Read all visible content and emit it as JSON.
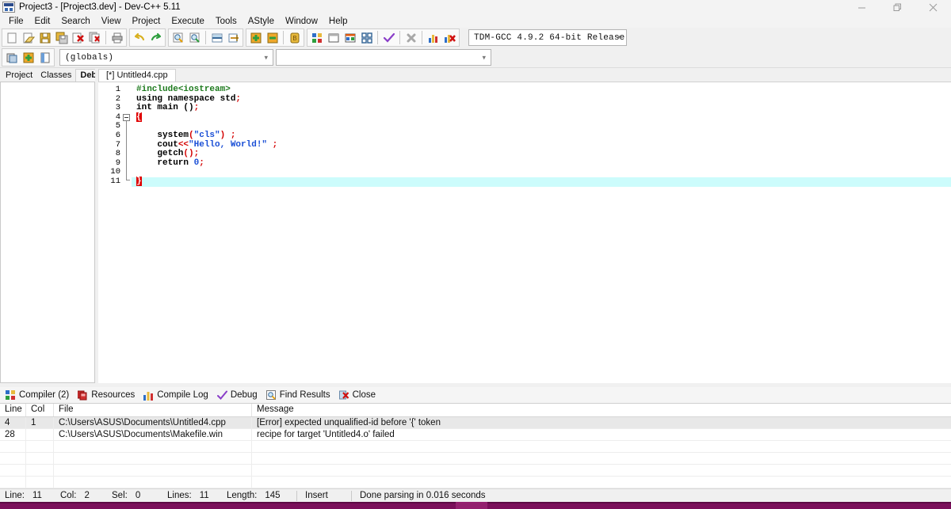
{
  "window": {
    "title": "Project3 - [Project3.dev] - Dev-C++ 5.11",
    "icon": "devcpp-app-icon",
    "controls": {
      "minimize": "minimize-icon",
      "maximize": "restore-icon",
      "close": "close-icon"
    }
  },
  "menubar": {
    "items": [
      {
        "label": "File"
      },
      {
        "label": "Edit"
      },
      {
        "label": "Search"
      },
      {
        "label": "View"
      },
      {
        "label": "Project"
      },
      {
        "label": "Execute"
      },
      {
        "label": "Tools"
      },
      {
        "label": "AStyle"
      },
      {
        "label": "Window"
      },
      {
        "label": "Help"
      }
    ]
  },
  "toolbar": {
    "file_group": [
      {
        "name": "new-file-icon",
        "title": "New"
      },
      {
        "name": "open-file-icon",
        "title": "Open"
      },
      {
        "name": "save-file-icon",
        "title": "Save"
      },
      {
        "name": "save-all-icon",
        "title": "Save All"
      },
      {
        "name": "close-file-icon",
        "title": "Close"
      },
      {
        "name": "close-all-icon",
        "title": "Close All"
      },
      {
        "name": "print-icon",
        "title": "Print"
      }
    ],
    "undo_group": [
      {
        "name": "undo-icon",
        "title": "Undo"
      },
      {
        "name": "redo-icon",
        "title": "Redo"
      }
    ],
    "search_group": [
      {
        "name": "find-icon",
        "title": "Find"
      },
      {
        "name": "replace-icon",
        "title": "Replace"
      },
      {
        "name": "goto-line-icon",
        "title": "Goto Line"
      },
      {
        "name": "goto-function-icon",
        "title": "Goto Function"
      }
    ],
    "project_group": [
      {
        "name": "add-to-project-icon",
        "title": "Add to Project"
      },
      {
        "name": "remove-from-project-icon",
        "title": "Remove from Project"
      },
      {
        "name": "project-options-icon",
        "title": "Project Options"
      }
    ],
    "compile_group": [
      {
        "name": "compile-icon",
        "title": "Compile"
      },
      {
        "name": "run-icon",
        "title": "Run"
      },
      {
        "name": "compile-run-icon",
        "title": "Compile & Run"
      },
      {
        "name": "rebuild-all-icon",
        "title": "Rebuild All"
      },
      {
        "name": "syntax-check-icon",
        "title": "Syntax Check"
      },
      {
        "name": "stop-execution-icon",
        "title": "Stop Execution"
      },
      {
        "name": "profile-icon",
        "title": "Profile Analysis"
      },
      {
        "name": "delete-profile-icon",
        "title": "Delete Profile"
      }
    ],
    "compiler_select": {
      "name": "compiler-set-combo",
      "value": "TDM-GCC 4.9.2 64-bit Release",
      "caret": "chevron-down-icon"
    },
    "debug_group": [
      {
        "name": "goto-declaration-icon",
        "title": "Goto Declaration"
      },
      {
        "name": "goto-definition-icon",
        "title": "Goto Definition"
      },
      {
        "name": "toggle-panel-icon",
        "title": "Toggle Panel"
      }
    ],
    "scope_combo": {
      "name": "scope-combo",
      "value": "(globals)",
      "caret": "chevron-down-icon"
    },
    "member_combo": {
      "name": "member-combo",
      "value": "",
      "caret": "chevron-down-icon"
    }
  },
  "left_panel": {
    "tabs": [
      {
        "label": "Project",
        "active": false
      },
      {
        "label": "Classes",
        "active": false
      },
      {
        "label": "Debug",
        "active": true
      }
    ]
  },
  "editor": {
    "tabs": [
      {
        "label": "[*] Untitled4.cpp",
        "active": true
      }
    ],
    "current_line": 11,
    "lines": [
      {
        "n": 1,
        "fold": "start-none",
        "tokens": [
          {
            "t": "#include",
            "c": "pre"
          },
          {
            "t": "<iostream>",
            "c": "pre2"
          }
        ]
      },
      {
        "n": 2,
        "tokens": [
          {
            "t": "using namespace std",
            "c": "kw"
          },
          {
            "t": ";",
            "c": "punc"
          }
        ]
      },
      {
        "n": 3,
        "tokens": [
          {
            "t": "int main ()",
            "c": "kw"
          },
          {
            "t": ";",
            "c": "punc"
          }
        ]
      },
      {
        "n": 4,
        "fold": "start",
        "tokens": [
          {
            "t": "{",
            "c": "brace"
          }
        ]
      },
      {
        "n": 5,
        "tokens": []
      },
      {
        "n": 6,
        "tokens": [
          {
            "t": "    system",
            "c": "plain"
          },
          {
            "t": "(",
            "c": "punc"
          },
          {
            "t": "\"cls\"",
            "c": "str"
          },
          {
            "t": ")",
            "c": "punc"
          },
          {
            "t": " ",
            "c": "plain"
          },
          {
            "t": ";",
            "c": "punc"
          }
        ]
      },
      {
        "n": 7,
        "tokens": [
          {
            "t": "    cout",
            "c": "plain"
          },
          {
            "t": "<<",
            "c": "punc"
          },
          {
            "t": "\"Hello, World!\"",
            "c": "str"
          },
          {
            "t": " ",
            "c": "plain"
          },
          {
            "t": ";",
            "c": "punc"
          }
        ]
      },
      {
        "n": 8,
        "tokens": [
          {
            "t": "    getch",
            "c": "plain"
          },
          {
            "t": "()",
            "c": "punc"
          },
          {
            "t": ";",
            "c": "punc"
          }
        ]
      },
      {
        "n": 9,
        "tokens": [
          {
            "t": "    return ",
            "c": "kw"
          },
          {
            "t": "0",
            "c": "num"
          },
          {
            "t": ";",
            "c": "punc"
          }
        ]
      },
      {
        "n": 10,
        "tokens": []
      },
      {
        "n": 11,
        "fold": "end",
        "highlight": true,
        "tokens": [
          {
            "t": "}",
            "c": "brace"
          }
        ]
      }
    ]
  },
  "bottom_panel": {
    "tabs": [
      {
        "label": "Compiler (2)",
        "icon": "compiler-icon",
        "active": true
      },
      {
        "label": "Resources",
        "icon": "resources-icon",
        "active": false
      },
      {
        "label": "Compile Log",
        "icon": "compile-log-icon",
        "active": false
      },
      {
        "label": "Debug",
        "icon": "debug-check-icon",
        "active": false
      },
      {
        "label": "Find Results",
        "icon": "find-results-icon",
        "active": false
      },
      {
        "label": "Close",
        "icon": "close-panel-icon",
        "active": false
      }
    ],
    "table": {
      "columns": [
        "Line",
        "Col",
        "File",
        "Message"
      ],
      "rows": [
        {
          "line": "4",
          "col": "1",
          "file": "C:\\Users\\ASUS\\Documents\\Untitled4.cpp",
          "message": "[Error] expected unqualified-id before '{' token",
          "selected": true
        },
        {
          "line": "28",
          "col": "",
          "file": "C:\\Users\\ASUS\\Documents\\Makefile.win",
          "message": "recipe for target 'Untitled4.o' failed",
          "selected": false
        },
        {
          "line": "",
          "col": "",
          "file": "",
          "message": "",
          "selected": false
        },
        {
          "line": "",
          "col": "",
          "file": "",
          "message": "",
          "selected": false
        },
        {
          "line": "",
          "col": "",
          "file": "",
          "message": "",
          "selected": false
        },
        {
          "line": "",
          "col": "",
          "file": "",
          "message": "",
          "selected": false
        },
        {
          "line": "",
          "col": "",
          "file": "",
          "message": "",
          "selected": false
        }
      ]
    }
  },
  "statusbar": {
    "line_label": "Line:",
    "line_value": "11",
    "col_label": "Col:",
    "col_value": "2",
    "sel_label": "Sel:",
    "sel_value": "0",
    "lines_label": "Lines:",
    "lines_value": "11",
    "length_label": "Length:",
    "length_value": "145",
    "insert_mode": "Insert",
    "parse_status": "Done parsing in 0.016 seconds"
  },
  "colors": {
    "window_bg": "#f0f0f0",
    "editor_bg": "#ffffff",
    "current_line": "#ccfcfc",
    "bracket_match_bg": "#e00000",
    "string": "#1a4fd6",
    "preprocessor": "#1d7a1d",
    "punctuation": "#d40000",
    "selected_row": "#e8e8e8",
    "taskbar": "#7a0f5a"
  }
}
